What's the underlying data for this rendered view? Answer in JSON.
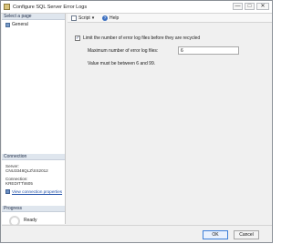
{
  "window": {
    "title": "Configure SQL Server Error Logs",
    "minimize_label": "—",
    "maximize_label": "□",
    "close_label": "✕"
  },
  "sidebar": {
    "select_page_header": "Select a page",
    "pages": [
      {
        "label": "General"
      }
    ],
    "connection_header": "Connection",
    "server_label": "Server:",
    "server_value": "CNU3348QLZ\\SS2012",
    "connection_label": "Connection:",
    "connection_value": "KREDITT\\t605",
    "view_properties_link": "View connection properties",
    "progress_header": "Progress",
    "progress_status": "Ready"
  },
  "toolbar": {
    "script_label": "Script",
    "script_dropdown_icon": "▾",
    "help_label": "Help"
  },
  "main": {
    "limit_checkbox_label": "Limit the number of error log files before they are recycled",
    "limit_checkbox_checked": true,
    "max_files_label": "Maximum number of error log files:",
    "max_files_value": "6",
    "range_hint": "Value must be between 6 and 99."
  },
  "footer": {
    "ok_label": "OK",
    "cancel_label": "Cancel"
  }
}
